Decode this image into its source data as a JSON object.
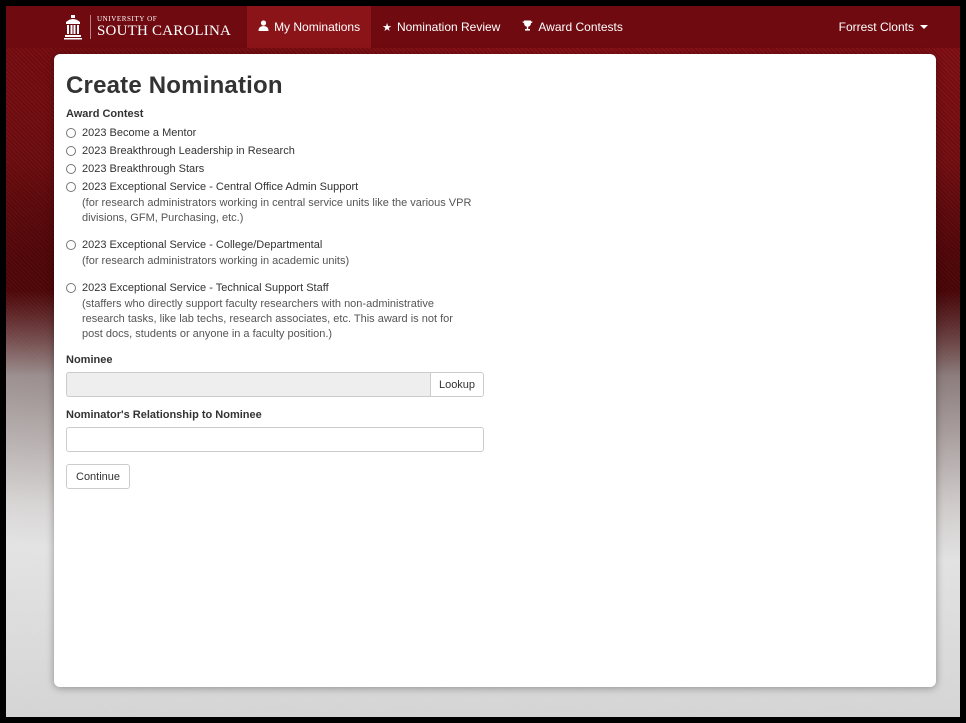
{
  "navbar": {
    "brand_top": "UNIVERSITY OF",
    "brand_bottom": "SOUTH CAROLINA",
    "items": [
      {
        "label": "My Nominations",
        "icon": "user-icon",
        "active": true
      },
      {
        "label": "Nomination Review",
        "icon": "star-icon",
        "active": false
      },
      {
        "label": "Award Contests",
        "icon": "trophy-icon",
        "active": false
      }
    ],
    "user": "Forrest Clonts"
  },
  "page": {
    "title": "Create Nomination",
    "award_contest_label": "Award Contest",
    "contests": [
      {
        "label": "2023 Become a Mentor",
        "help": ""
      },
      {
        "label": "2023 Breakthrough Leadership in Research",
        "help": ""
      },
      {
        "label": "2023 Breakthrough Stars",
        "help": ""
      },
      {
        "label": "2023 Exceptional Service - Central Office Admin Support",
        "help": "(for research administrators working in central service units like the various VPR divisions, GFM, Purchasing, etc.)"
      },
      {
        "label": "2023 Exceptional Service - College/Departmental",
        "help": "(for research administrators working in academic units)"
      },
      {
        "label": "2023 Exceptional Service - Technical Support Staff",
        "help": "(staffers who directly support faculty researchers with non-administrative research tasks, like lab techs, research associates, etc. This award is not for post docs, students or anyone in a faculty position.)"
      }
    ],
    "nominee_label": "Nominee",
    "nominee_value": "",
    "lookup_label": "Lookup",
    "relationship_label": "Nominator's Relationship to Nominee",
    "relationship_value": "",
    "continue_label": "Continue"
  },
  "colors": {
    "navbar": "#6e0a10",
    "navbar_active": "#8b1419"
  }
}
